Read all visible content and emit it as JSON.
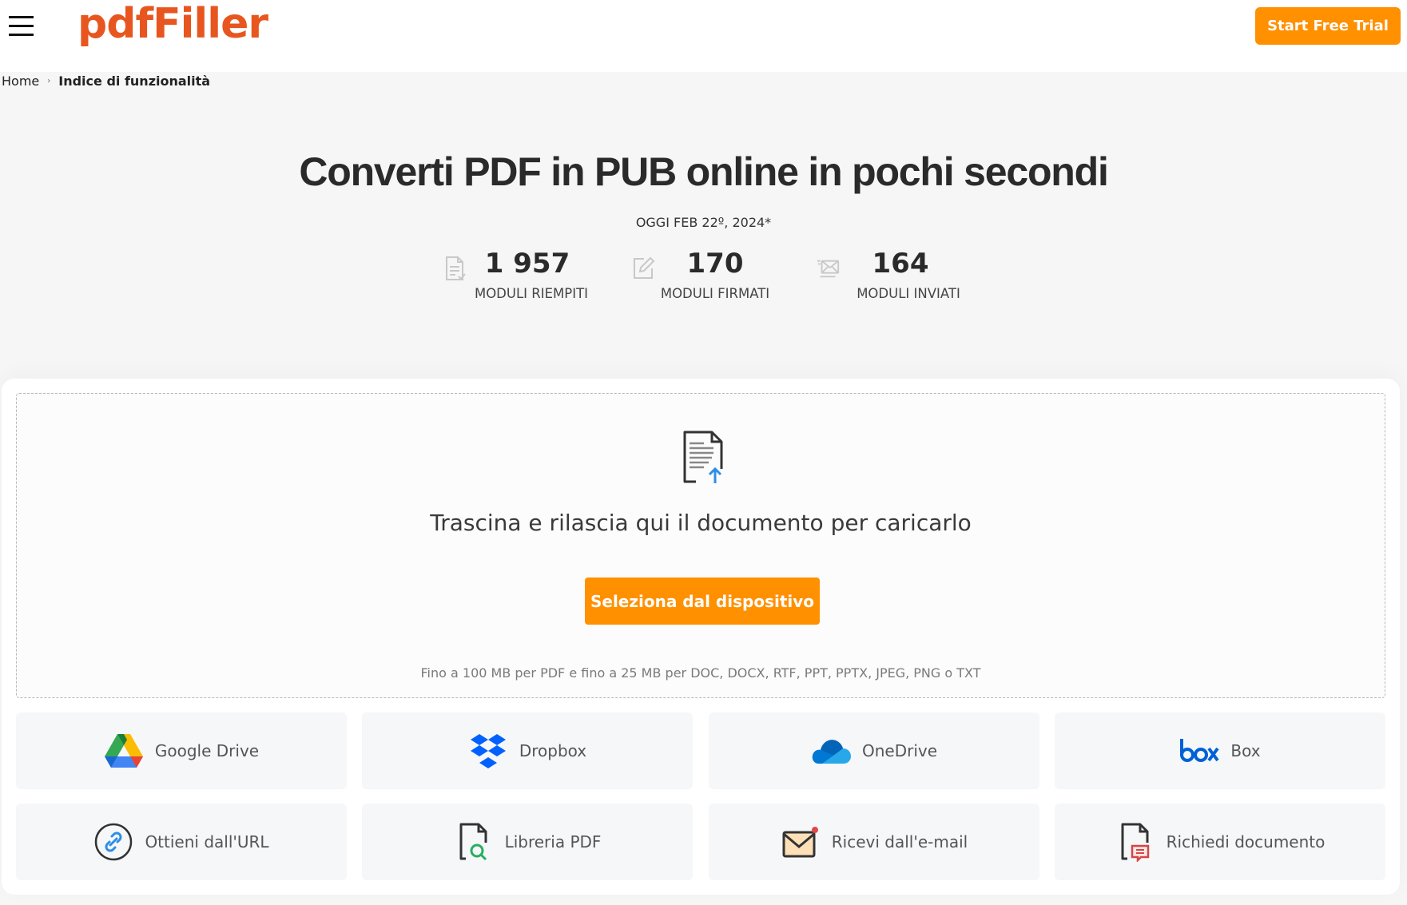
{
  "header": {
    "logo": "pdfFiller",
    "menu_icon": "hamburger-menu-icon",
    "cta_label": "Start Free Trial",
    "brand_color": "#e8561f",
    "accent_color": "#ff9000"
  },
  "breadcrumb": [
    {
      "label": "Home"
    },
    {
      "label": "Indice di funzionalità"
    }
  ],
  "hero": {
    "title": "Converti PDF in PUB online in pochi secondi",
    "date": "OGGI FEB 22º, 2024*",
    "stats": [
      {
        "icon": "filled-form-icon",
        "value": "1 957",
        "label": "MODULI RIEMPITI"
      },
      {
        "icon": "signed-form-icon",
        "value": "170",
        "label": "MODULI FIRMATI"
      },
      {
        "icon": "sent-form-icon",
        "value": "164",
        "label": "MODULI INVIATI"
      }
    ]
  },
  "upload": {
    "icon": "document-upload-icon",
    "drop_text": "Trascina e rilascia qui il documento per caricarlo",
    "button_label": "Seleziona dal dispositivo",
    "limits_text": "Fino a 100 MB per PDF e fino a 25 MB per DOC, DOCX, RTF, PPT, PPTX, JPEG, PNG o TXT"
  },
  "sources": [
    {
      "icon": "google-drive-icon",
      "label": "Google Drive"
    },
    {
      "icon": "dropbox-icon",
      "label": "Dropbox"
    },
    {
      "icon": "onedrive-icon",
      "label": "OneDrive"
    },
    {
      "icon": "box-icon",
      "label": "Box"
    },
    {
      "icon": "link-icon",
      "label": "Ottieni dall'URL"
    },
    {
      "icon": "pdf-library-icon",
      "label": "Libreria PDF"
    },
    {
      "icon": "email-icon",
      "label": "Ricevi dall'e-mail"
    },
    {
      "icon": "request-document-icon",
      "label": "Richiedi documento"
    }
  ]
}
